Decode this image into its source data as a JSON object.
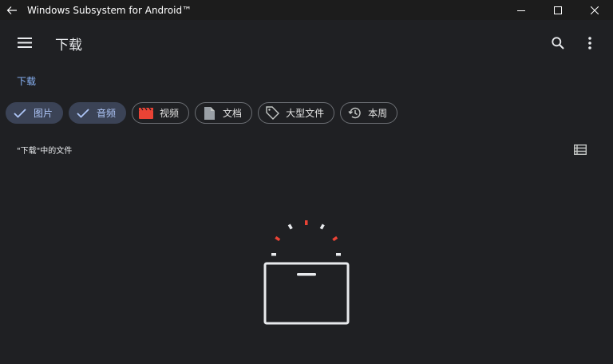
{
  "window": {
    "title": "Windows Subsystem for Android™",
    "back_icon": "arrow-left-icon",
    "controls": [
      "minimize-icon",
      "maximize-icon",
      "close-icon"
    ]
  },
  "appbar": {
    "title": "下载",
    "menu_icon": "hamburger-menu-icon",
    "search_icon": "search-icon",
    "more_icon": "more-vert-icon"
  },
  "breadcrumb": "下载",
  "filters": [
    {
      "label": "图片",
      "icon": "check-icon",
      "selected": true
    },
    {
      "label": "音频",
      "icon": "check-icon",
      "selected": true
    },
    {
      "label": "视频",
      "icon": "video-icon",
      "selected": false
    },
    {
      "label": "文档",
      "icon": "document-icon",
      "selected": false
    },
    {
      "label": "大型文件",
      "icon": "tag-icon",
      "selected": false
    },
    {
      "label": "本周",
      "icon": "history-icon",
      "selected": false
    }
  ],
  "section": {
    "title": "\"下载\"中的文件",
    "view_icon": "list-view-icon"
  },
  "empty_state": {
    "illustration": "empty-box-icon"
  },
  "colors": {
    "background": "#1f2023",
    "accent": "#8ab4f8",
    "selected_chip": "#3b4356",
    "video_red": "#ea4335"
  }
}
